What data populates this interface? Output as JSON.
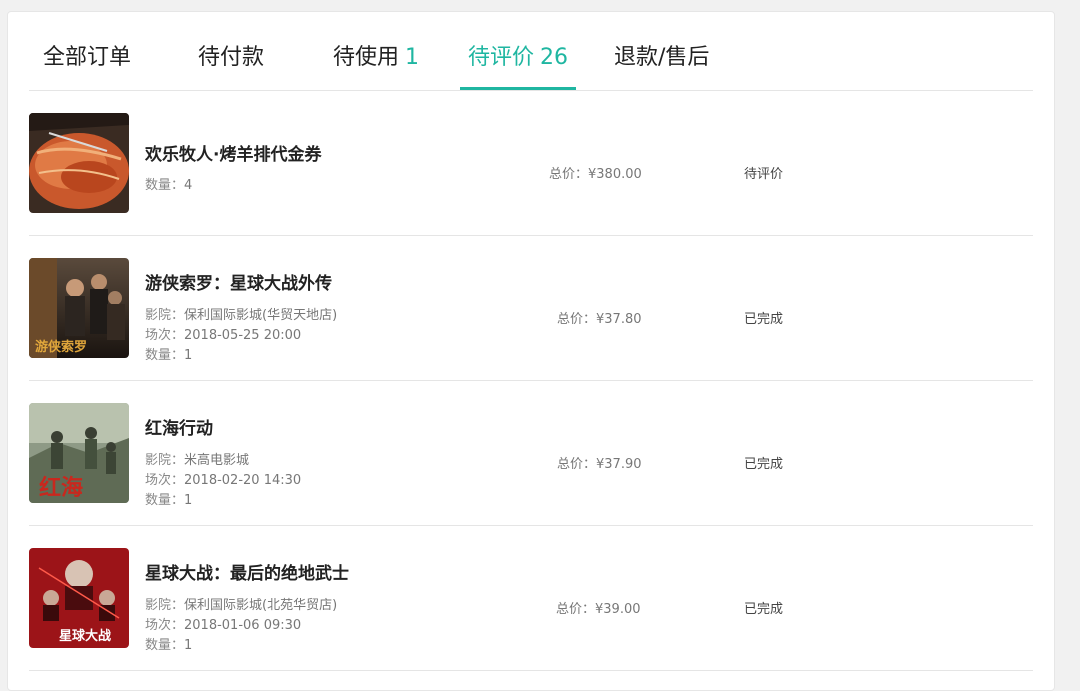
{
  "tabs": [
    {
      "label": "全部订单",
      "count": ""
    },
    {
      "label": "待付款",
      "count": ""
    },
    {
      "label": "待使用",
      "count": "1"
    },
    {
      "label": "待评价",
      "count": "26"
    },
    {
      "label": "退款/售后",
      "count": ""
    }
  ],
  "active_tab": "待评价",
  "orders": [
    {
      "title": "欢乐牧人·烤羊排代金券",
      "quantity_label": "数量：",
      "quantity": "4",
      "price_label": "总价：",
      "price": "¥380.00",
      "status": "待评价"
    },
    {
      "title": "游侠索罗：星球大战外传",
      "cinema_label": "影院：",
      "cinema": "保利国际影城(华贸天地店)",
      "session_label": "场次：",
      "session": "2018-05-25 20:00",
      "quantity_label": "数量：",
      "quantity": "1",
      "price_label": "总价：",
      "price": "¥37.80",
      "status": "已完成",
      "poster_text": "游侠索罗"
    },
    {
      "title": "红海行动",
      "cinema_label": "影院：",
      "cinema": "米高电影城",
      "session_label": "场次：",
      "session": "2018-02-20 14:30",
      "quantity_label": "数量：",
      "quantity": "1",
      "price_label": "总价：",
      "price": "¥37.90",
      "status": "已完成",
      "poster_text": "红海"
    },
    {
      "title": "星球大战：最后的绝地武士",
      "cinema_label": "影院：",
      "cinema": "保利国际影城(北苑华贸店)",
      "session_label": "场次：",
      "session": "2018-01-06 09:30",
      "quantity_label": "数量：",
      "quantity": "1",
      "price_label": "总价：",
      "price": "¥39.00",
      "status": "已完成",
      "poster_text": "星球大战"
    }
  ],
  "colors": {
    "accent": "#1fb6a1",
    "divider": "#e5e5e5"
  }
}
